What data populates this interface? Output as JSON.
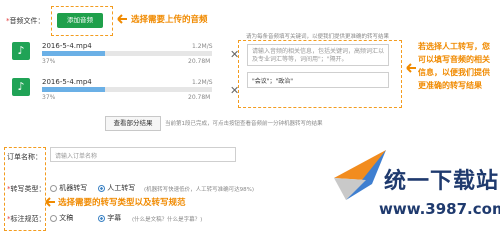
{
  "upload": {
    "label": "音频文件：",
    "add_button": "添加音频",
    "callout": "选择需要上传的音频"
  },
  "files": [
    {
      "name": "2016-5-4.mp4",
      "speed": "1.2M/S",
      "percent_text": "37%",
      "progress": 0.37,
      "size": "20.78M"
    },
    {
      "name": "2016-5-4.mp4",
      "speed": "1.2M/S",
      "percent_text": "37%",
      "progress": 0.37,
      "size": "20.78M"
    }
  ],
  "hint": {
    "top": "请为每条音频填写关键词，以便我们提供更准确的转写结果",
    "placeholder": "请输入音频的相关信息，包括关键词，高频词汇以及专业词汇等等，词间用\"；\"隔开。",
    "example": "\"会议\"；\"政治\""
  },
  "manual_note": {
    "line1": "若选择人工转写，您",
    "line2": "可以填写音频的相关",
    "line3": "信息，以便我们提供",
    "line4": "更准确的转写结果"
  },
  "view_results": {
    "button": "查看部分结果",
    "desc": "当前第1段已完成，可点击按钮查看音频前一分钟机器转写的结果"
  },
  "order": {
    "label": "订单名称：",
    "placeholder": "请输入订单名称"
  },
  "transcribe": {
    "label": "转写类型：",
    "option_machine": "机器转写",
    "option_human": "人工转写",
    "note": "(机器转写快速低价，人工转写准确可达98%)"
  },
  "annotation": {
    "label": "标注规范：",
    "option_text": "文稿",
    "option_subtitle": "字幕",
    "note": "(什么是文稿？什么是字幕？)"
  },
  "bottom_callout": "选择需要的转写类型以及转写规范",
  "watermark": {
    "title": "统一下载站",
    "url": "www.3987.com"
  },
  "colors": {
    "accent_green": "#1fa04b",
    "callout_orange": "#f08a00",
    "progress_blue": "#6bb0e6"
  }
}
